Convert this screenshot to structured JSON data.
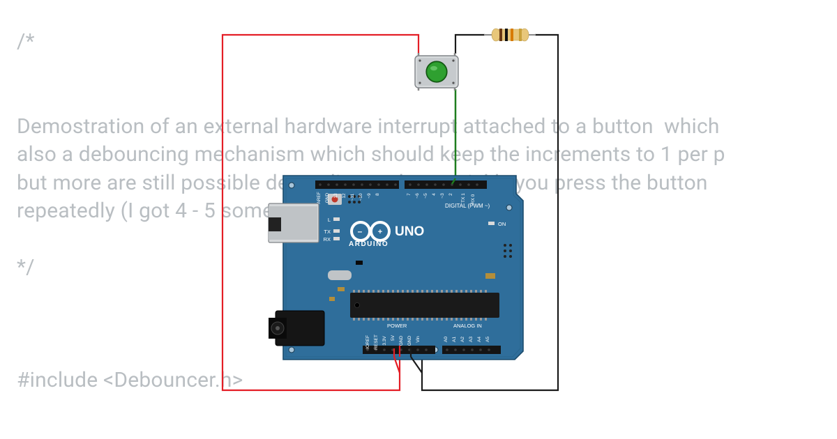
{
  "code": {
    "line1": "/*",
    "desc1": "Demostration of an external hardware interrupt attached to a button  which",
    "desc2": "also a debouncing mechanism which should keep the increments to 1 per p",
    "desc3": "but more are still possible depending on how quickly you press the button",
    "desc4": "repeatedly (I got 4 - 5 some",
    "line2": "*/",
    "include": "#include <Debouncer.h>"
  },
  "board": {
    "brand": "ARDUINO",
    "model": "UNO",
    "logo_minus": "–",
    "logo_plus": "+",
    "digital_label": "DIGITAL (PWM ~)",
    "analog_label": "ANALOG IN",
    "power_label": "POWER",
    "on_label": "ON",
    "l_label": "L",
    "tx_label": "TX",
    "rx_label": "RX",
    "tx1_label": "TX 1",
    "rx0_label": "RX 0",
    "pins_top": [
      "AREF",
      "GND",
      "13",
      "12",
      "~11",
      "~10",
      "~9",
      "8",
      "",
      "7",
      "~6",
      "~5",
      "4",
      "~3",
      "2",
      "TX 1",
      "RX 0"
    ],
    "pins_bottom_power": [
      "IOREF",
      "RESET",
      "3.3V",
      "5V",
      "GND",
      "GND",
      "Vin"
    ],
    "pins_bottom_analog": [
      "A0",
      "A1",
      "A2",
      "A3",
      "A4",
      "A5"
    ]
  },
  "components": {
    "button": "tactile-push-button",
    "resistor": "axial-resistor"
  },
  "colors": {
    "board_pcb": "#2F6E9B",
    "board_pcb_dark": "#245979",
    "wire_red": "#E41E26",
    "wire_black": "#1a1a1a",
    "wire_green": "#1E7D1E",
    "button_green": "#2FA030",
    "button_body": "#B8BCC0",
    "resistor_body": "#E8C77A",
    "text_overlay": "rgba(100,110,120,0.45)"
  }
}
